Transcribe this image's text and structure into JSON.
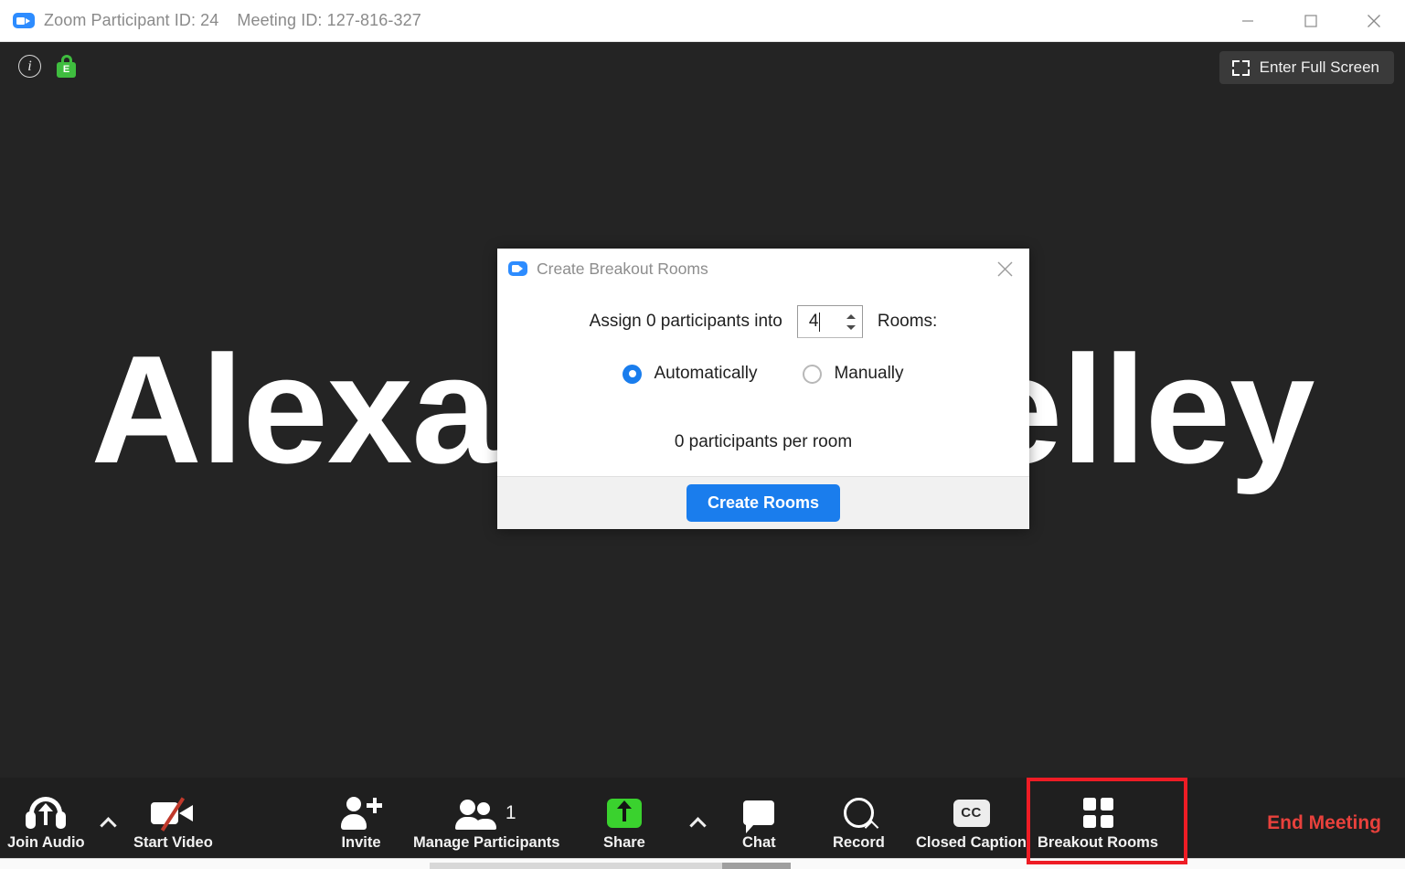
{
  "window": {
    "app_icon": "zoom-logo-icon",
    "participant_id_text": "Zoom Participant ID: 24",
    "meeting_id_text": "Meeting ID: 127-816-327",
    "controls": {
      "minimize": "minimize-icon",
      "maximize": "maximize-icon",
      "close": "close-icon"
    }
  },
  "video": {
    "speaker_name": "Alexander Kelley",
    "background_color": "#242424",
    "info_icon_label": "i",
    "encryption_badge_letter": "E",
    "encryption_color": "#3fbd3f",
    "fullscreen_label": "Enter Full Screen"
  },
  "dialog": {
    "title": "Create Breakout Rooms",
    "close_label": "×",
    "assign_prefix": "Assign 0 participants into",
    "rooms_count": "4",
    "assign_suffix": "Rooms:",
    "options": [
      {
        "label": "Automatically",
        "selected": true
      },
      {
        "label": "Manually",
        "selected": false
      }
    ],
    "per_room_text": "0 participants per room",
    "primary_button": "Create Rooms",
    "accent_color": "#1a7ded"
  },
  "toolbar": {
    "items": [
      {
        "label": "Join Audio",
        "icon": "headset-up-arrow-icon",
        "has_chevron": true
      },
      {
        "label": "Start Video",
        "icon": "camera-off-icon",
        "has_chevron": false
      },
      {
        "label": "Invite",
        "icon": "person-plus-icon",
        "has_chevron": false
      },
      {
        "label": "Manage Participants",
        "icon": "people-icon",
        "badge": "1",
        "has_chevron": false
      },
      {
        "label": "Share",
        "icon": "share-up-arrow-icon",
        "has_chevron": true
      },
      {
        "label": "Chat",
        "icon": "chat-bubble-icon",
        "has_chevron": false
      },
      {
        "label": "Record",
        "icon": "record-circle-icon",
        "has_chevron": false
      },
      {
        "label": "Closed Caption",
        "icon": "cc-icon",
        "has_chevron": false
      },
      {
        "label": "Breakout Rooms",
        "icon": "grid-four-icon",
        "has_chevron": false,
        "highlighted": true
      }
    ],
    "end_meeting_label": "End Meeting",
    "end_meeting_color": "#e8413c",
    "highlight_color": "#ee1c25"
  }
}
